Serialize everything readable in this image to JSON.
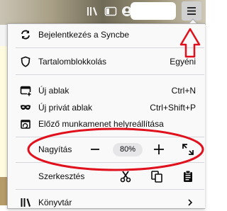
{
  "menu": {
    "sign_in": "Bejelentkezés a Syncbe",
    "content_blocking": {
      "label": "Tartalomblokkolás",
      "value": "Egyéni"
    },
    "new_window": {
      "label": "Új ablak",
      "shortcut": "Ctrl+N"
    },
    "new_private_window": {
      "label": "Új privát ablak",
      "shortcut": "Ctrl+Shift+P"
    },
    "restore_session": "Előző munkamenet helyreállítása",
    "zoom": {
      "label": "Nagyítás",
      "minus": "−",
      "value": "80%",
      "plus": "+"
    },
    "edit": {
      "label": "Szerkesztés"
    },
    "library": "Könyvtár"
  },
  "icons": {
    "toolbar": [
      "library-icon",
      "sidebar-icon",
      "account-icon",
      "hamburger-menu-icon"
    ],
    "menu": [
      "sync-icon",
      "shield-icon",
      "new-window-icon",
      "mask-icon",
      "restore-icon",
      "fullscreen-icon",
      "cut-icon",
      "copy-icon",
      "paste-icon",
      "library-icon",
      "chevron-right-icon"
    ]
  },
  "colors": {
    "annotation": "#e0101c",
    "panel_bg": "#f9f9fa",
    "separator": "#d7d7db"
  }
}
